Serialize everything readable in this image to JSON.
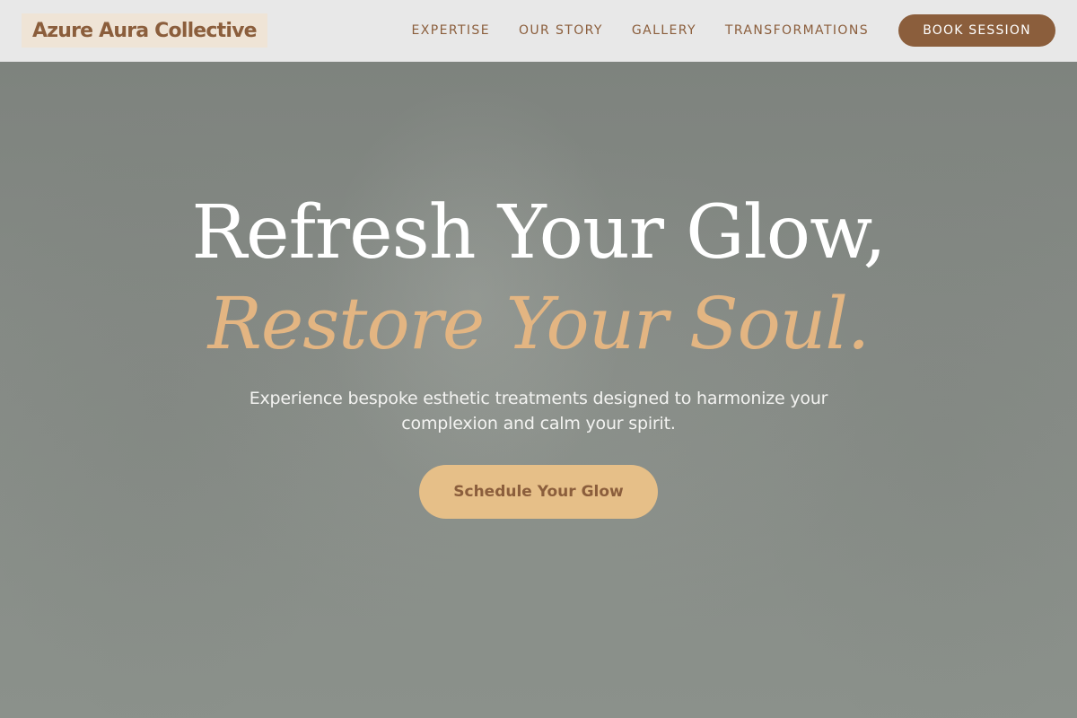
{
  "brand": {
    "name": "Azure Aura Collective"
  },
  "nav": {
    "links": [
      "EXPERTISE",
      "OUR STORY",
      "GALLERY",
      "TRANSFORMATIONS"
    ],
    "book_label": "BOOK SESSION"
  },
  "hero": {
    "headline_line1": "Refresh Your Glow,",
    "headline_line2": "Restore Your Soul.",
    "subtitle": "Experience bespoke esthetic treatments designed to harmonize your complexion and calm your spirit.",
    "cta_label": "Schedule Your Glow"
  },
  "colors": {
    "brand_brown": "#8b5e3c",
    "accent_gold": "#e3b582",
    "cta_background": "#e6bf88",
    "nav_background": "#e8e8e8",
    "hero_overlay": "#858a85"
  }
}
